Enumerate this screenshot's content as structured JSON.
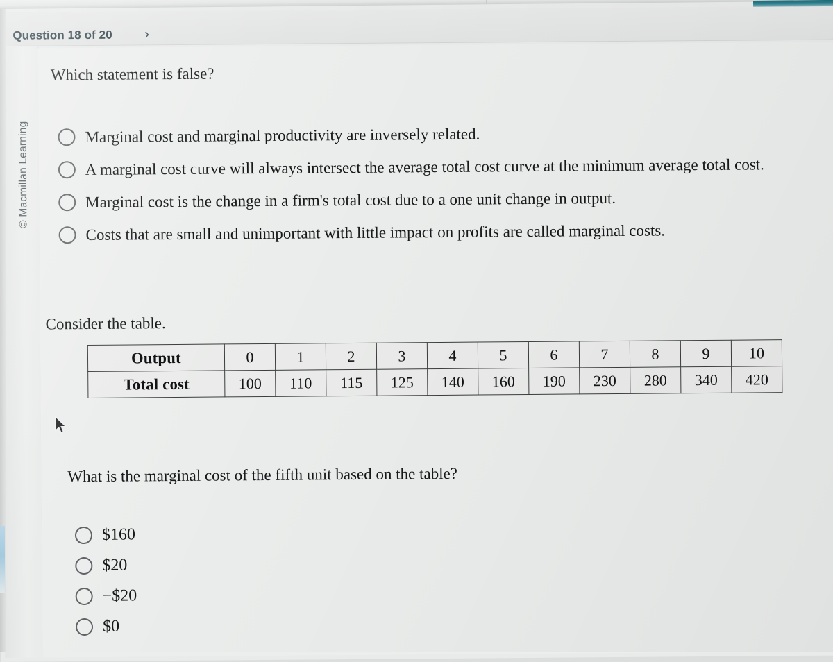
{
  "header": {
    "question_counter": "Question 18 of 20",
    "next_chevron": "›",
    "chevron_icon_name": "chevron-right-icon"
  },
  "sidebar": {
    "copyright": "© Macmillan Learning"
  },
  "question_one": {
    "prompt": "Which statement is false?",
    "options": [
      {
        "label": "Marginal cost and marginal productivity are inversely related."
      },
      {
        "label": "A marginal cost curve will always intersect the average total cost curve at the minimum average total cost."
      },
      {
        "label": "Marginal cost is the change in a firm's total cost due to a one unit change in output."
      },
      {
        "label": "Costs that are small and unimportant with little impact on profits are called marginal costs."
      }
    ]
  },
  "table_intro": "Consider the table.",
  "chart_data": {
    "type": "table",
    "title": "Consider the table.",
    "row_headers": [
      "Output",
      "Total cost"
    ],
    "categories": [
      "0",
      "1",
      "2",
      "3",
      "4",
      "5",
      "6",
      "7",
      "8",
      "9",
      "10"
    ],
    "series": [
      {
        "name": "Total cost",
        "values": [
          100,
          110,
          115,
          125,
          140,
          160,
          190,
          230,
          280,
          340,
          420
        ]
      }
    ],
    "xlabel": "Output",
    "ylabel": "Total cost",
    "grid": true,
    "legend": "none"
  },
  "question_two": {
    "prompt": "What is the marginal cost of the fifth unit based on the table?",
    "options": [
      {
        "label": "$160"
      },
      {
        "label": "$20"
      },
      {
        "label": "−$20"
      },
      {
        "label": "$0"
      }
    ]
  },
  "colors": {
    "header_text": "#2c3e46",
    "body_text": "#17191a",
    "page_background": "#eceeed",
    "rail_background": "#e9ebea",
    "table_border": "#3b3d3e",
    "accent_strip": "#2f8492"
  },
  "cursor": {
    "icon": "mouse-pointer-icon"
  }
}
